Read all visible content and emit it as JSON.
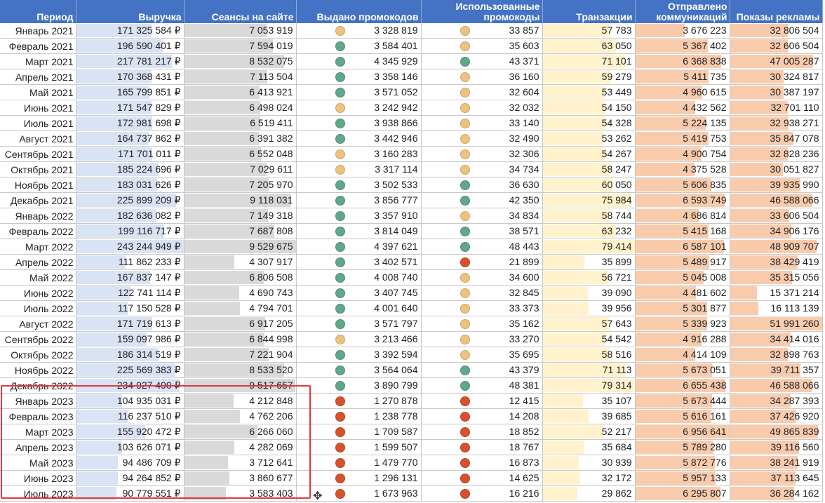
{
  "headers": [
    "Период",
    "Выручка",
    "Сеансы на сайте",
    "Выдано промокодов",
    "Использованные промокоды",
    "Транзакции",
    "Отправлено коммуникаций",
    "Показы рекламы"
  ],
  "colors": {
    "header": "#4472c4",
    "revenue_bar": "#dae3f3",
    "sessions_bar": "#d9d9d9",
    "transactions_bar": "#fff2cc",
    "comms_bar": "#f8cbad",
    "ads_bar": "#f8cbad",
    "green": "#5fa88a",
    "amber": "#eec27e",
    "red": "#d9512c",
    "highlight": "#e0393e"
  },
  "max": {
    "revenue": 243244949,
    "sessions": 9529675,
    "transactions": 79414,
    "comms": 6956641,
    "ads": 51991260
  },
  "rows": [
    {
      "period": "Январь 2021",
      "revenue": "171 325 584 ₽",
      "rv": 171325584,
      "sessions": "7 053 919",
      "sv": 7053919,
      "issued": "3 328 819",
      "issued_status": "amber",
      "used": "33 857",
      "used_status": "amber",
      "transactions": "57 783",
      "tv": 57783,
      "comms": "3 676 223",
      "cv": 3676223,
      "ads": "32 806 504",
      "av": 32806504
    },
    {
      "period": "Февраль 2021",
      "revenue": "196 590 401 ₽",
      "rv": 196590401,
      "sessions": "7 594 019",
      "sv": 7594019,
      "issued": "3 584 401",
      "issued_status": "green",
      "used": "35 603",
      "used_status": "amber",
      "transactions": "63 050",
      "tv": 63050,
      "comms": "5 367 402",
      "cv": 5367402,
      "ads": "32 606 504",
      "av": 32606504
    },
    {
      "period": "Март 2021",
      "revenue": "217 781 217 ₽",
      "rv": 217781217,
      "sessions": "8 532 075",
      "sv": 8532075,
      "issued": "4 345 929",
      "issued_status": "green",
      "used": "43 371",
      "used_status": "green",
      "transactions": "71 101",
      "tv": 71101,
      "comms": "6 368 838",
      "cv": 6368838,
      "ads": "47 005 287",
      "av": 47005287
    },
    {
      "period": "Апрель 2021",
      "revenue": "170 368 431 ₽",
      "rv": 170368431,
      "sessions": "7 113 504",
      "sv": 7113504,
      "issued": "3 358 146",
      "issued_status": "green",
      "used": "36 160",
      "used_status": "amber",
      "transactions": "59 279",
      "tv": 59279,
      "comms": "5 411 735",
      "cv": 5411735,
      "ads": "30 324 817",
      "av": 30324817
    },
    {
      "period": "Май 2021",
      "revenue": "165 799 851 ₽",
      "rv": 165799851,
      "sessions": "6 413 921",
      "sv": 6413921,
      "issued": "3 571 052",
      "issued_status": "green",
      "used": "32 604",
      "used_status": "amber",
      "transactions": "53 449",
      "tv": 53449,
      "comms": "4 960 615",
      "cv": 4960615,
      "ads": "30 387 197",
      "av": 30387197
    },
    {
      "period": "Июнь 2021",
      "revenue": "171 547 829 ₽",
      "rv": 171547829,
      "sessions": "6 498 024",
      "sv": 6498024,
      "issued": "3 242 942",
      "issued_status": "amber",
      "used": "32 032",
      "used_status": "amber",
      "transactions": "54 150",
      "tv": 54150,
      "comms": "4 432 562",
      "cv": 4432562,
      "ads": "32 701 110",
      "av": 32701110
    },
    {
      "period": "Июль 2021",
      "revenue": "172 981 698 ₽",
      "rv": 172981698,
      "sessions": "6 519 411",
      "sv": 6519411,
      "issued": "3 938 866",
      "issued_status": "green",
      "used": "33 140",
      "used_status": "amber",
      "transactions": "54 328",
      "tv": 54328,
      "comms": "5 224 135",
      "cv": 5224135,
      "ads": "32 938 271",
      "av": 32938271
    },
    {
      "period": "Август 2021",
      "revenue": "164 737 862 ₽",
      "rv": 164737862,
      "sessions": "6 391 382",
      "sv": 6391382,
      "issued": "3 442 946",
      "issued_status": "green",
      "used": "32 490",
      "used_status": "amber",
      "transactions": "53 262",
      "tv": 53262,
      "comms": "5 419 753",
      "cv": 5419753,
      "ads": "35 847 078",
      "av": 35847078
    },
    {
      "period": "Сентябрь 2021",
      "revenue": "171 701 011 ₽",
      "rv": 171701011,
      "sessions": "6 552 048",
      "sv": 6552048,
      "issued": "3 160 283",
      "issued_status": "amber",
      "used": "32 306",
      "used_status": "amber",
      "transactions": "54 267",
      "tv": 54267,
      "comms": "4 900 754",
      "cv": 4900754,
      "ads": "32 828 236",
      "av": 32828236
    },
    {
      "period": "Октябрь 2021",
      "revenue": "185 224 696 ₽",
      "rv": 185224696,
      "sessions": "7 029 611",
      "sv": 7029611,
      "issued": "3 317 114",
      "issued_status": "amber",
      "used": "34 734",
      "used_status": "amber",
      "transactions": "58 247",
      "tv": 58247,
      "comms": "4 375 528",
      "cv": 4375528,
      "ads": "30 051 827",
      "av": 30051827
    },
    {
      "period": "Ноябрь 2021",
      "revenue": "183 031 626 ₽",
      "rv": 183031626,
      "sessions": "7 205 970",
      "sv": 7205970,
      "issued": "3 502 533",
      "issued_status": "green",
      "used": "36 630",
      "used_status": "green",
      "transactions": "60 050",
      "tv": 60050,
      "comms": "5 606 835",
      "cv": 5606835,
      "ads": "39 935 990",
      "av": 39935990
    },
    {
      "period": "Декабрь 2021",
      "revenue": "225 899 209 ₽",
      "rv": 225899209,
      "sessions": "9 118 031",
      "sv": 9118031,
      "issued": "3 856 777",
      "issued_status": "green",
      "used": "42 350",
      "used_status": "green",
      "transactions": "75 984",
      "tv": 75984,
      "comms": "6 593 749",
      "cv": 6593749,
      "ads": "46 588 066",
      "av": 46588066
    },
    {
      "period": "Январь 2022",
      "revenue": "182 636 082 ₽",
      "rv": 182636082,
      "sessions": "7 149 318",
      "sv": 7149318,
      "issued": "3 357 910",
      "issued_status": "green",
      "used": "34 834",
      "used_status": "amber",
      "transactions": "58 744",
      "tv": 58744,
      "comms": "4 686 814",
      "cv": 4686814,
      "ads": "33 606 504",
      "av": 33606504
    },
    {
      "period": "Февраль 2022",
      "revenue": "199 116 717 ₽",
      "rv": 199116717,
      "sessions": "7 687 808",
      "sv": 7687808,
      "issued": "3 814 049",
      "issued_status": "green",
      "used": "38 571",
      "used_status": "green",
      "transactions": "63 232",
      "tv": 63232,
      "comms": "5 415 168",
      "cv": 5415168,
      "ads": "34 906 176",
      "av": 34906176
    },
    {
      "period": "Март 2022",
      "revenue": "243 244 949 ₽",
      "rv": 243244949,
      "sessions": "9 529 675",
      "sv": 9529675,
      "issued": "4 397 621",
      "issued_status": "green",
      "used": "48 443",
      "used_status": "green",
      "transactions": "79 414",
      "tv": 79414,
      "comms": "6 587 101",
      "cv": 6587101,
      "ads": "48 909 707",
      "av": 48909707
    },
    {
      "period": "Апрель 2022",
      "revenue": "111 862 233 ₽",
      "rv": 111862233,
      "sessions": "4 307 917",
      "sv": 4307917,
      "issued": "3 402 571",
      "issued_status": "green",
      "used": "21 899",
      "used_status": "red",
      "transactions": "35 899",
      "tv": 35899,
      "comms": "5 489 917",
      "cv": 5489917,
      "ads": "38 429 419",
      "av": 38429419
    },
    {
      "period": "Май 2022",
      "revenue": "167 837 147 ₽",
      "rv": 167837147,
      "sessions": "6 806 508",
      "sv": 6806508,
      "issued": "4 008 740",
      "issued_status": "green",
      "used": "34 600",
      "used_status": "amber",
      "transactions": "56 721",
      "tv": 56721,
      "comms": "5 045 008",
      "cv": 5045008,
      "ads": "35 315 056",
      "av": 35315056
    },
    {
      "period": "Июнь 2022",
      "revenue": "122 741 114 ₽",
      "rv": 122741114,
      "sessions": "4 690 743",
      "sv": 4690743,
      "issued": "3 407 745",
      "issued_status": "green",
      "used": "32 845",
      "used_status": "amber",
      "transactions": "39 090",
      "tv": 39090,
      "comms": "4 481 602",
      "cv": 4481602,
      "ads": "15 371 214",
      "av": 15371214
    },
    {
      "period": "Июль 2022",
      "revenue": "117 150 528 ₽",
      "rv": 117150528,
      "sessions": "4 794 701",
      "sv": 4794701,
      "issued": "4 001 640",
      "issued_status": "green",
      "used": "33 373",
      "used_status": "amber",
      "transactions": "39 956",
      "tv": 39956,
      "comms": "5 301 877",
      "cv": 5301877,
      "ads": "16 113 139",
      "av": 16113139
    },
    {
      "period": "Август 2022",
      "revenue": "171 719 613 ₽",
      "rv": 171719613,
      "sessions": "6 917 205",
      "sv": 6917205,
      "issued": "3 571 797",
      "issued_status": "green",
      "used": "35 162",
      "used_status": "amber",
      "transactions": "57 643",
      "tv": 57643,
      "comms": "5 339 923",
      "cv": 5339923,
      "ads": "51 991 260",
      "av": 51991260
    },
    {
      "period": "Сентябрь 2022",
      "revenue": "159 097 986 ₽",
      "rv": 159097986,
      "sessions": "6 844 998",
      "sv": 6844998,
      "issued": "3 213 466",
      "issued_status": "amber",
      "used": "33 270",
      "used_status": "amber",
      "transactions": "54 542",
      "tv": 54542,
      "comms": "4 916 288",
      "cv": 4916288,
      "ads": "34 414 016",
      "av": 34414016
    },
    {
      "period": "Октябрь 2022",
      "revenue": "186 314 519 ₽",
      "rv": 186314519,
      "sessions": "7 221 904",
      "sv": 7221904,
      "issued": "3 392 594",
      "issued_status": "green",
      "used": "35 695",
      "used_status": "amber",
      "transactions": "58 516",
      "tv": 58516,
      "comms": "4 414 109",
      "cv": 4414109,
      "ads": "32 898 763",
      "av": 32898763
    },
    {
      "period": "Ноябрь 2022",
      "revenue": "225 569 383 ₽",
      "rv": 225569383,
      "sessions": "8 533 520",
      "sv": 8533520,
      "issued": "3 564 064",
      "issued_status": "green",
      "used": "43 379",
      "used_status": "green",
      "transactions": "71 113",
      "tv": 71113,
      "comms": "5 673 051",
      "cv": 5673051,
      "ads": "39 711 357",
      "av": 39711357
    },
    {
      "period": "Декабрь 2022",
      "revenue": "234 927 490 ₽",
      "rv": 234927490,
      "sessions": "9 517 657",
      "sv": 9517657,
      "issued": "3 890 799",
      "issued_status": "green",
      "used": "48 381",
      "used_status": "green",
      "transactions": "79 314",
      "tv": 79314,
      "comms": "6 655 438",
      "cv": 6655438,
      "ads": "46 588 066",
      "av": 46588066
    },
    {
      "period": "Январь 2023",
      "revenue": "104 935 031 ₽",
      "rv": 104935031,
      "sessions": "4 212 848",
      "sv": 4212848,
      "issued": "1 270 878",
      "issued_status": "red",
      "used": "12 415",
      "used_status": "red",
      "transactions": "35 107",
      "tv": 35107,
      "comms": "5 673 444",
      "cv": 5673444,
      "ads": "34 287 393",
      "av": 34287393
    },
    {
      "period": "Февраль 2023",
      "revenue": "116 237 510 ₽",
      "rv": 116237510,
      "sessions": "4 762 206",
      "sv": 4762206,
      "issued": "1 238 778",
      "issued_status": "red",
      "used": "14 208",
      "used_status": "red",
      "transactions": "39 685",
      "tv": 39685,
      "comms": "5 616 161",
      "cv": 5616161,
      "ads": "37 426 920",
      "av": 37426920
    },
    {
      "period": "Март 2023",
      "revenue": "155 920 472 ₽",
      "rv": 155920472,
      "sessions": "6 266 060",
      "sv": 6266060,
      "issued": "1 709 587",
      "issued_status": "red",
      "used": "18 852",
      "used_status": "red",
      "transactions": "52 217",
      "tv": 52217,
      "comms": "6 956 641",
      "cv": 6956641,
      "ads": "49 865 839",
      "av": 49865839
    },
    {
      "period": "Апрель 2023",
      "revenue": "103 626 071 ₽",
      "rv": 103626071,
      "sessions": "4 282 069",
      "sv": 4282069,
      "issued": "1 599 507",
      "issued_status": "red",
      "used": "18 767",
      "used_status": "red",
      "transactions": "35 684",
      "tv": 35684,
      "comms": "5 789 280",
      "cv": 5789280,
      "ads": "39 116 560",
      "av": 39116560
    },
    {
      "period": "Май 2023",
      "revenue": "94 486 709 ₽",
      "rv": 94486709,
      "sessions": "3 712 641",
      "sv": 3712641,
      "issued": "1 479 770",
      "issued_status": "red",
      "used": "16 873",
      "used_status": "red",
      "transactions": "30 939",
      "tv": 30939,
      "comms": "5 872 776",
      "cv": 5872776,
      "ads": "38 241 919",
      "av": 38241919
    },
    {
      "period": "Июнь 2023",
      "revenue": "94 264 852 ₽",
      "rv": 94264852,
      "sessions": "3 860 677",
      "sv": 3860677,
      "issued": "1 296 131",
      "issued_status": "red",
      "used": "14 625",
      "used_status": "red",
      "transactions": "32 172",
      "tv": 32172,
      "comms": "5 957 133",
      "cv": 5957133,
      "ads": "37 113 645",
      "av": 37113645
    },
    {
      "period": "Июль 2023",
      "revenue": "90 779 551 ₽",
      "rv": 90779551,
      "sessions": "3 583 403",
      "sv": 3583403,
      "issued": "1 673 963",
      "issued_status": "red",
      "used": "16 216",
      "used_status": "red",
      "transactions": "29 862",
      "tv": 29862,
      "comms": "6 295 807",
      "cv": 6295807,
      "ads": "36 284 162",
      "av": 36284162
    }
  ]
}
